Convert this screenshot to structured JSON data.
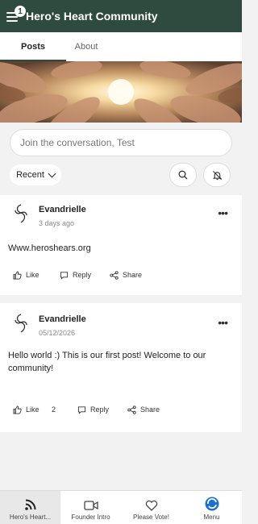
{
  "header": {
    "menu_badge": "1",
    "title": "Hero's Heart Community"
  },
  "tabs": [
    {
      "label": "Posts",
      "active": true
    },
    {
      "label": "About",
      "active": false
    }
  ],
  "composer": {
    "placeholder": "Join the conversation, Test"
  },
  "filters": {
    "sort_label": "Recent"
  },
  "posts": [
    {
      "author": "Evandrielle",
      "time": "3 days ago",
      "text": "Www.heroshears.org",
      "like": "Like",
      "like_count": "",
      "reply": "Reply",
      "share": "Share"
    },
    {
      "author": "Evandrielle",
      "time": "05/12/2026",
      "text": "Hello world :) This is our first post! Welcome to our community!",
      "like": "Like",
      "like_count": "2",
      "reply": "Reply",
      "share": "Share"
    }
  ],
  "bottom_nav": [
    {
      "label": "Hero's Heart...",
      "icon": "feed-icon",
      "active": true
    },
    {
      "label": "Founder Intro",
      "icon": "video-icon",
      "active": false
    },
    {
      "label": "Please Vote!",
      "icon": "heart-icon",
      "active": false
    },
    {
      "label": "Menu",
      "icon": "app-logo-icon",
      "active": false
    }
  ],
  "colors": {
    "header_bg": "#2f4b40",
    "accent": "#2f4b40",
    "logo_blue": "#1a6fd1"
  }
}
